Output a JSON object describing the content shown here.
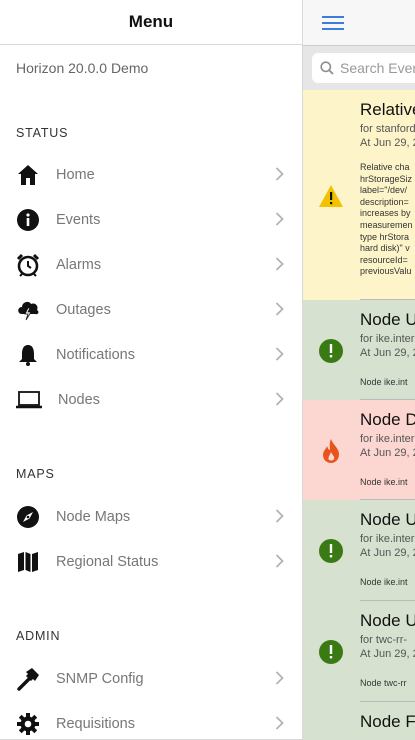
{
  "menu": {
    "title": "Menu",
    "version": "Horizon 20.0.0 Demo",
    "sections": {
      "status": "STATUS",
      "maps": "MAPS",
      "admin": "ADMIN"
    },
    "items": {
      "home": "Home",
      "events": "Events",
      "alarms": "Alarms",
      "outages": "Outages",
      "notifications": "Notifications",
      "nodes": "Nodes",
      "node_maps": "Node Maps",
      "regional_status": "Regional Status",
      "snmp_config": "SNMP Config",
      "requisitions": "Requisitions"
    }
  },
  "search": {
    "placeholder": "Search Events"
  },
  "events": [
    {
      "title": "Relative",
      "subtitle": "for stanford",
      "time": "At Jun 29, 2",
      "description": "Relative cha\nhrStorageSiz\nlabel=\"/dev/\ndescription=\nincreases by\nmeasuremen\ntype hrStora\nhard disk)\" v\nresourceId=\npreviousValu",
      "severity": "warning",
      "color": "#fdf5c9"
    },
    {
      "title": "Node U",
      "subtitle": "for ike.inter",
      "time": "At Jun 29, 2",
      "description": "Node ike.int",
      "severity": "normal",
      "color": "#d6e2cf"
    },
    {
      "title": "Node D",
      "subtitle": "for ike.inter",
      "time": "At Jun 29, 2",
      "description": "Node ike.int",
      "severity": "major",
      "color": "#fcd7d1"
    },
    {
      "title": "Node U",
      "subtitle": "for ike.inter",
      "time": "At Jun 29, 2",
      "description": "Node ike.int",
      "severity": "normal",
      "color": "#d6e2cf"
    },
    {
      "title": "Node U",
      "subtitle": "for twc-rr-",
      "time": "At Jun 29, 2",
      "description": "Node twc-rr",
      "severity": "normal",
      "color": "#d6e2cf"
    },
    {
      "title": "Node F",
      "subtitle": "",
      "time": "",
      "description": "",
      "severity": "normal",
      "color": "#d6e2cf"
    }
  ],
  "colors": {
    "accent": "#3b7dd8",
    "warning_icon": "#f2c200",
    "normal_icon": "#3a7a14",
    "major_icon": "#e8541e"
  },
  "icons": {
    "hamburger": "hamburger-icon",
    "search": "search-icon",
    "chevron": "chevron-right-icon"
  }
}
